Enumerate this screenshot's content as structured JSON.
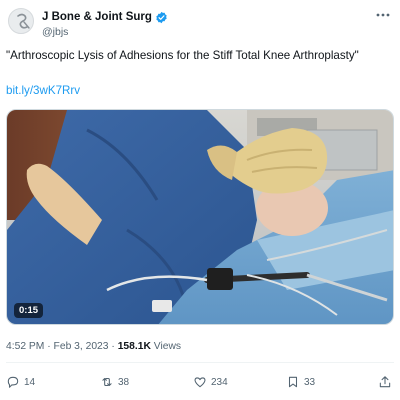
{
  "tweet": {
    "author": {
      "display_name": "J Bone & Joint Surg",
      "handle": "@jbjs",
      "verified_icon": "verified-badge-icon",
      "avatar_icon": "jbjs-logo-icon"
    },
    "more_icon": "more-options-icon",
    "text": "\"Arthroscopic Lysis of Adhesions for the Stiff Total Knee Arthroplasty\"",
    "link": "bit.ly/3wK7Rrv",
    "media": {
      "type": "video",
      "duration": "0:15"
    },
    "meta": {
      "time": "4:52 PM",
      "separator": "·",
      "date": "Feb 3, 2023",
      "views_count": "158.1K",
      "views_label": "Views"
    },
    "actions": {
      "replies": {
        "icon": "reply-icon",
        "count": "14"
      },
      "retweets": {
        "icon": "retweet-icon",
        "count": "38"
      },
      "likes": {
        "icon": "like-icon",
        "count": "234"
      },
      "bookmarks": {
        "icon": "bookmark-icon",
        "count": "33"
      },
      "share": {
        "icon": "share-icon"
      }
    }
  },
  "colors": {
    "text_primary": "#0f1419",
    "text_secondary": "#536471",
    "link": "#1d9bf0",
    "verified": "#1d9bf0"
  }
}
